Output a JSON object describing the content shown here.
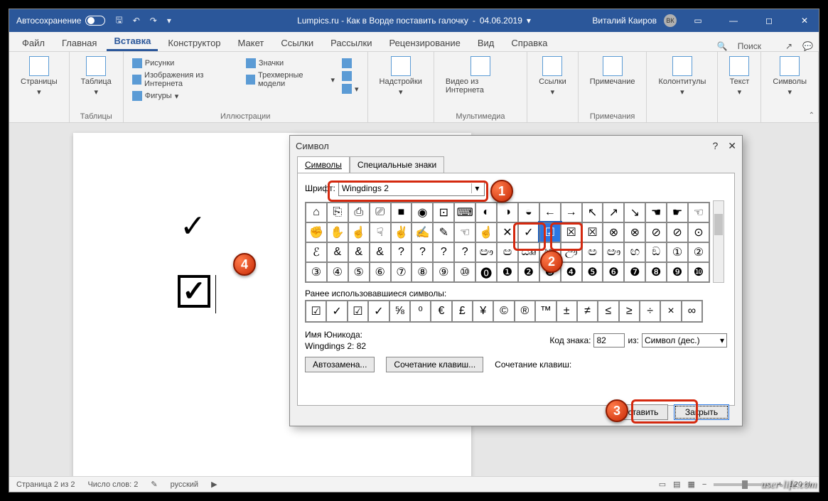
{
  "title_bar": {
    "autosave": "Автосохранение",
    "doc_title": "Lumpics.ru - Как в Ворде поставить галочку",
    "doc_date": "04.06.2019",
    "user_name": "Виталий Каиров",
    "user_initials": "ВК"
  },
  "tabs": {
    "file": "Файл",
    "home": "Главная",
    "insert": "Вставка",
    "design": "Конструктор",
    "layout": "Макет",
    "references": "Ссылки",
    "mailings": "Рассылки",
    "review": "Рецензирование",
    "view": "Вид",
    "help": "Справка",
    "search": "Поиск"
  },
  "ribbon": {
    "pages": "Страницы",
    "table": "Таблица",
    "tables_group": "Таблицы",
    "pictures": "Рисунки",
    "online_pictures": "Изображения из Интернета",
    "shapes": "Фигуры",
    "icons": "Значки",
    "models3d": "Трехмерные модели",
    "illustrations_group": "Иллюстрации",
    "addins": "Надстройки",
    "online_video": "Видео из Интернета",
    "media_group": "Мультимедиа",
    "links": "Ссылки",
    "comment": "Примечание",
    "comments_group": "Примечания",
    "header_footer": "Колонтитулы",
    "text": "Текст",
    "symbols": "Символы"
  },
  "dialog": {
    "title": "Символ",
    "tab_symbols": "Символы",
    "tab_special": "Специальные знаки",
    "font_label": "Шрифт:",
    "font_value": "Wingdings 2",
    "recent_label": "Ранее использовавшиеся символы:",
    "unicode_label": "Имя Юникода:",
    "unicode_value": "Wingdings 2: 82",
    "code_label": "Код знака:",
    "code_value": "82",
    "from_label": "из:",
    "from_value": "Символ (дес.)",
    "autocorrect": "Автозамена...",
    "shortcut_key": "Сочетание клавиш...",
    "shortcut_label": "Сочетание клавиш:",
    "insert": "Вставить",
    "close": "Закрыть",
    "grid_rows": [
      [
        "⌂",
        "⎘",
        "⎙",
        "⎚",
        "■",
        "◉",
        "⊡",
        "⌨",
        "◐",
        "◑",
        "◒",
        "←",
        "→",
        "↖",
        "↗",
        "↘",
        "☚",
        "☛",
        "☜"
      ],
      [
        "✊",
        "✋",
        "☝",
        "☟",
        "✌",
        "✍",
        "✎",
        "☜",
        "☝",
        "✕",
        "✓",
        "☑",
        "☒",
        "☒",
        "⊗",
        "⊗",
        "⊘",
        "⊘",
        "⊙"
      ],
      [
        "ℰ",
        "&",
        "&",
        "&",
        "?",
        "?",
        "?",
        "?",
        "ඐ",
        "ඏ",
        "ඎ",
        "ඍ",
        "ඌ",
        "ඏ",
        "ඐ",
        "ඟ",
        "ඞ",
        "①",
        "②"
      ],
      [
        "③",
        "④",
        "⑤",
        "⑥",
        "⑦",
        "⑧",
        "⑨",
        "⑩",
        "⓿",
        "❶",
        "❷",
        "❸",
        "❹",
        "❺",
        "❻",
        "❼",
        "❽",
        "❾",
        "❿"
      ]
    ],
    "recent": [
      "☑",
      "✓",
      "☑",
      "✓",
      "⅝",
      "⁰",
      "€",
      "£",
      "¥",
      "©",
      "®",
      "™",
      "±",
      "≠",
      "≤",
      "≥",
      "÷",
      "×",
      "∞"
    ]
  },
  "status": {
    "page": "Страница 2 из 2",
    "words": "Число слов: 2",
    "lang": "русский",
    "zoom": "120 %"
  },
  "callouts": {
    "c1": "1",
    "c2": "2",
    "c3": "3",
    "c4": "4"
  },
  "watermark": "user-life.com"
}
